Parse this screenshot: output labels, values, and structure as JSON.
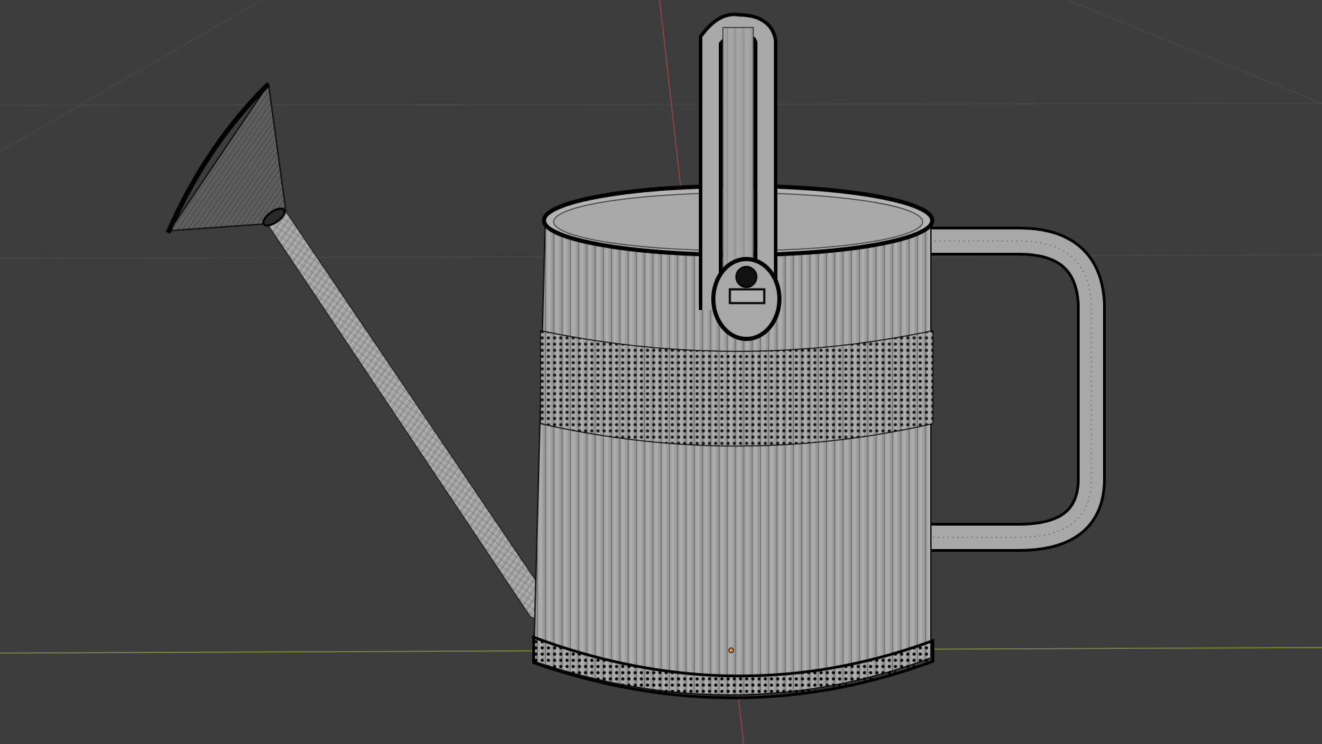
{
  "viewport": {
    "mode": "3d-viewport",
    "shading": "solid-with-wireframe-overlay",
    "object": "watering-can",
    "background_color": "#3d3d3d",
    "grid_line_color": "#474747",
    "x_axis_color": "#8a9a3c",
    "y_axis_color": "#b04848",
    "mesh_fill_color": "#a6a6a6",
    "mesh_edge_color": "#1a1a1a",
    "vertex_color": "#000000",
    "origin_color": "#e0902a"
  }
}
